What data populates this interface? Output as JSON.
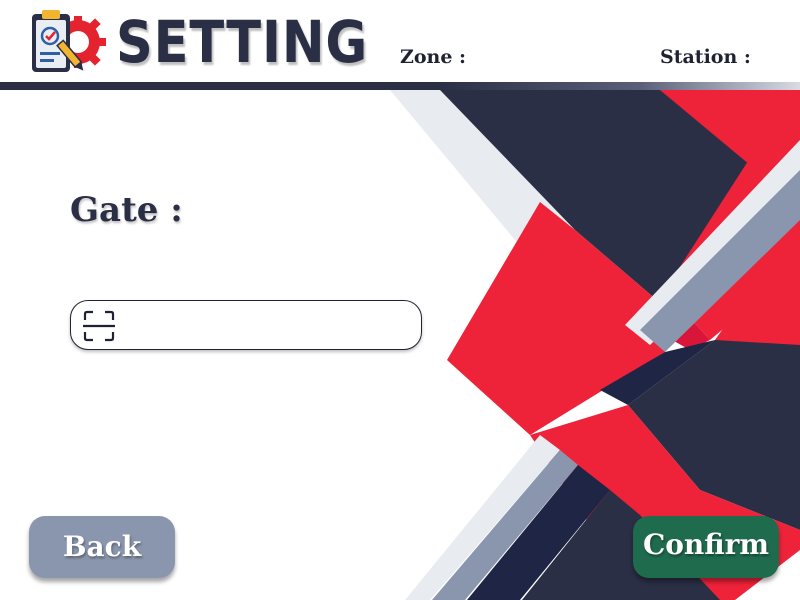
{
  "header": {
    "title": "SETTING",
    "zone_label": "Zone :",
    "station_label": "Station :"
  },
  "icons": {
    "logo": "settings-clipboard-icon",
    "scan": "scan-frame-icon"
  },
  "gate": {
    "label": "Gate :",
    "value": "",
    "placeholder": ""
  },
  "buttons": {
    "back_label": "Back",
    "confirm_label": "Confirm"
  },
  "colors": {
    "navy": "#2b2f45",
    "red": "#ee2239",
    "back_button": "#8a96ad",
    "confirm_button": "#1f6b4e"
  }
}
